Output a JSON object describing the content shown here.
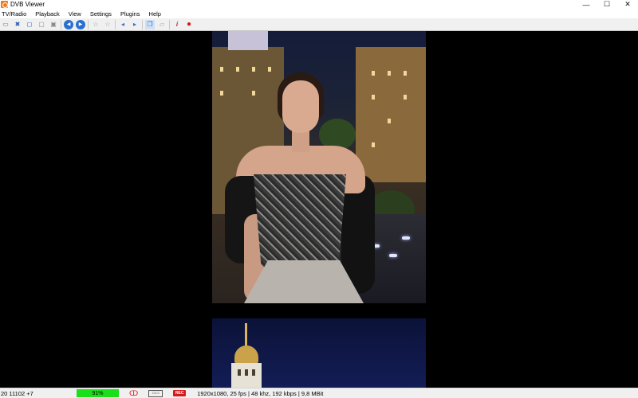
{
  "window": {
    "title": "DVB Viewer",
    "controls": [
      "—",
      "☐",
      "✕"
    ]
  },
  "menu": {
    "items": [
      "TV/Radio",
      "Playback",
      "View",
      "Settings",
      "Plugins",
      "Help"
    ]
  },
  "toolbar": {
    "buttons": [
      {
        "icon": "monitor-icon",
        "glyph": "▭"
      },
      {
        "icon": "fullscreen-icon",
        "glyph": "✖"
      },
      {
        "icon": "window-mode-icon",
        "glyph": "◻"
      },
      {
        "icon": "tile-icon",
        "glyph": "▢"
      },
      {
        "icon": "overlay-icon",
        "glyph": "▣"
      },
      {
        "icon": "channel-back-icon",
        "glyph": "◀"
      },
      {
        "icon": "channel-forward-icon",
        "glyph": "▶"
      },
      {
        "icon": "favorite-star-icon",
        "glyph": "☆"
      },
      {
        "icon": "favorite-star-2-icon",
        "glyph": "☆"
      },
      {
        "icon": "volume-down-icon",
        "glyph": "◂"
      },
      {
        "icon": "volume-up-icon",
        "glyph": "▸"
      },
      {
        "icon": "copy-icon",
        "glyph": "❐"
      },
      {
        "icon": "paste-icon",
        "glyph": "▱"
      },
      {
        "icon": "epg-info-icon",
        "glyph": "i"
      },
      {
        "icon": "record-icon",
        "glyph": "●"
      }
    ]
  },
  "status": {
    "channel": "20 11102 +7",
    "signal": "91%",
    "rec_label": "REC",
    "info": "1920x1080, 25 fps | 48 khz, 192 kbps | 9,8 MBit"
  },
  "colors": {
    "signal": "#19e019",
    "record": "#d41b1b",
    "app_icon": "#f07a1a"
  }
}
